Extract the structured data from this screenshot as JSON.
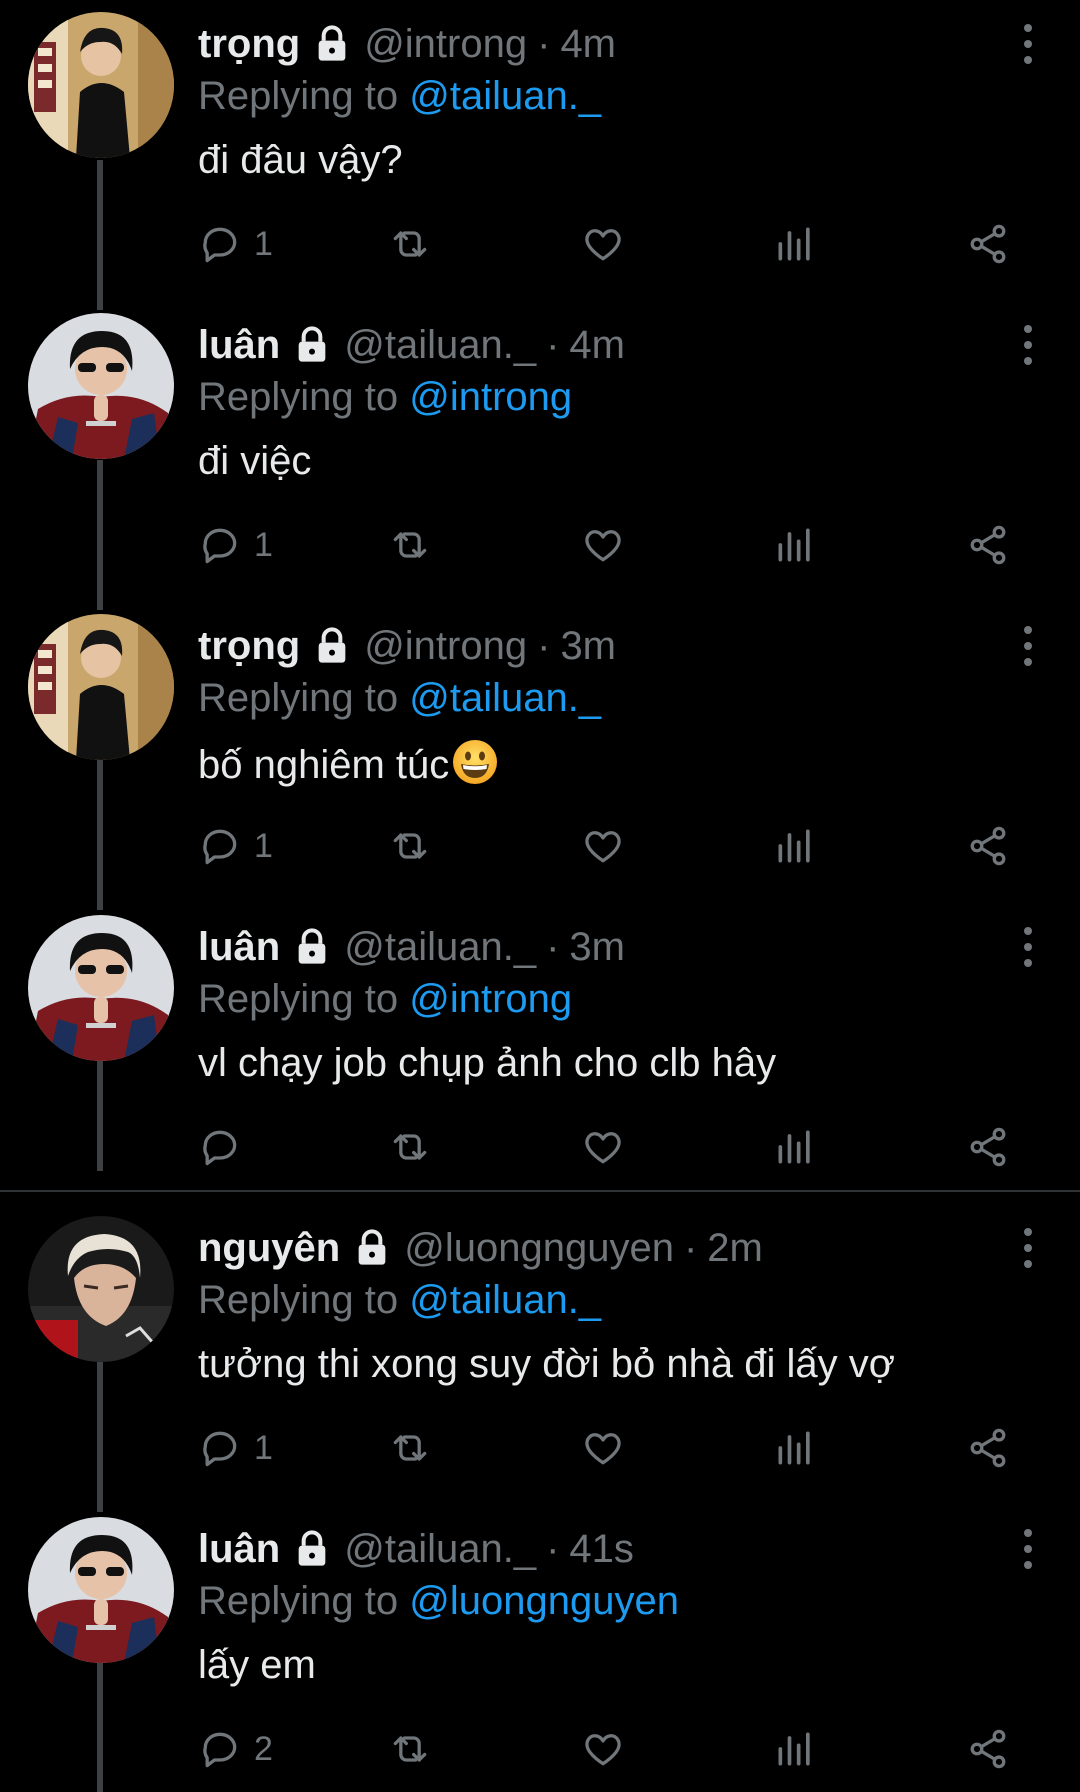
{
  "theme": {
    "background": "#000000",
    "text": "#e7e9ea",
    "muted": "#71767b",
    "accent": "#1d9bf0",
    "thread_line": "#3e4144"
  },
  "tweets": [
    {
      "name": "trọng",
      "handle": "@introng",
      "time": "4m",
      "replying_label": "Replying to",
      "replying_to": "@tailuan._",
      "text": "đi đâu vậy?",
      "reply_count": "1",
      "avatar": "avatar-trong",
      "lock_icon": "lock-icon",
      "more_icon": "more-vertical-icon"
    },
    {
      "name": "luân",
      "handle": "@tailuan._",
      "time": "4m",
      "replying_label": "Replying to",
      "replying_to": "@introng",
      "text": "đi việc",
      "reply_count": "1",
      "avatar": "avatar-luan",
      "lock_icon": "lock-icon",
      "more_icon": "more-vertical-icon"
    },
    {
      "name": "trọng",
      "handle": "@introng",
      "time": "3m",
      "replying_label": "Replying to",
      "replying_to": "@tailuan._",
      "text": "bố nghiêm túc",
      "emoji": "grinning-face-emoji",
      "reply_count": "1",
      "avatar": "avatar-trong",
      "lock_icon": "lock-icon",
      "more_icon": "more-vertical-icon"
    },
    {
      "name": "luân",
      "handle": "@tailuan._",
      "time": "3m",
      "replying_label": "Replying to",
      "replying_to": "@introng",
      "text": "vl chạy job chụp ảnh cho clb hây",
      "reply_count": "",
      "avatar": "avatar-luan",
      "lock_icon": "lock-icon",
      "more_icon": "more-vertical-icon"
    },
    {
      "name": "nguyên",
      "handle": "@luongnguyen",
      "time": "2m",
      "replying_label": "Replying to",
      "replying_to": "@tailuan._",
      "text": "tưởng thi xong suy đời bỏ nhà đi lấy vợ",
      "reply_count": "1",
      "avatar": "avatar-nguyen",
      "lock_icon": "lock-icon",
      "more_icon": "more-vertical-icon"
    },
    {
      "name": "luân",
      "handle": "@tailuan._",
      "time": "41s",
      "replying_label": "Replying to",
      "replying_to": "@luongnguyen",
      "text": "lấy em",
      "reply_count": "2",
      "avatar": "avatar-luan",
      "lock_icon": "lock-icon",
      "more_icon": "more-vertical-icon"
    }
  ],
  "actions": [
    "reply-icon",
    "retweet-icon",
    "like-icon",
    "views-icon",
    "share-icon"
  ],
  "separator": "·"
}
